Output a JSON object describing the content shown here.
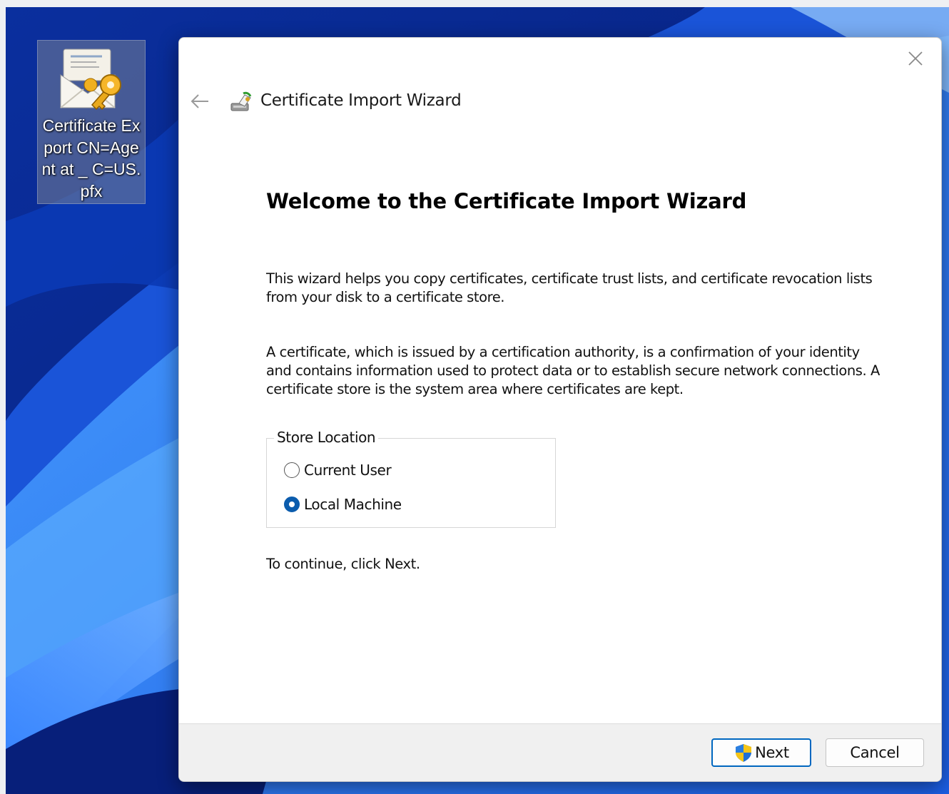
{
  "desktop": {
    "icon": {
      "label": "Certificate Export CN=Agent at _ C=US.pfx",
      "icon_name": "pfx-certificate-file-icon"
    }
  },
  "dialog": {
    "title": "Certificate Import Wizard",
    "heading": "Welcome to the Certificate Import Wizard",
    "paragraph1": "This wizard helps you copy certificates, certificate trust lists, and certificate revocation lists from your disk to a certificate store.",
    "paragraph2": "A certificate, which is issued by a certification authority, is a confirmation of your identity and contains information used to protect data or to establish secure network connections. A certificate store is the system area where certificates are kept.",
    "store_location": {
      "legend": "Store Location",
      "options": [
        {
          "label": "Current User",
          "selected": false
        },
        {
          "label": "Local Machine",
          "selected": true
        }
      ]
    },
    "continue_text": "To continue, click Next.",
    "buttons": {
      "next": "Next",
      "cancel": "Cancel"
    }
  },
  "colors": {
    "accent": "#0067c0",
    "radio_selected": "#0b5cad",
    "wallpaper_dark": "#0b2a8c",
    "wallpaper_light": "#3d8bff"
  }
}
